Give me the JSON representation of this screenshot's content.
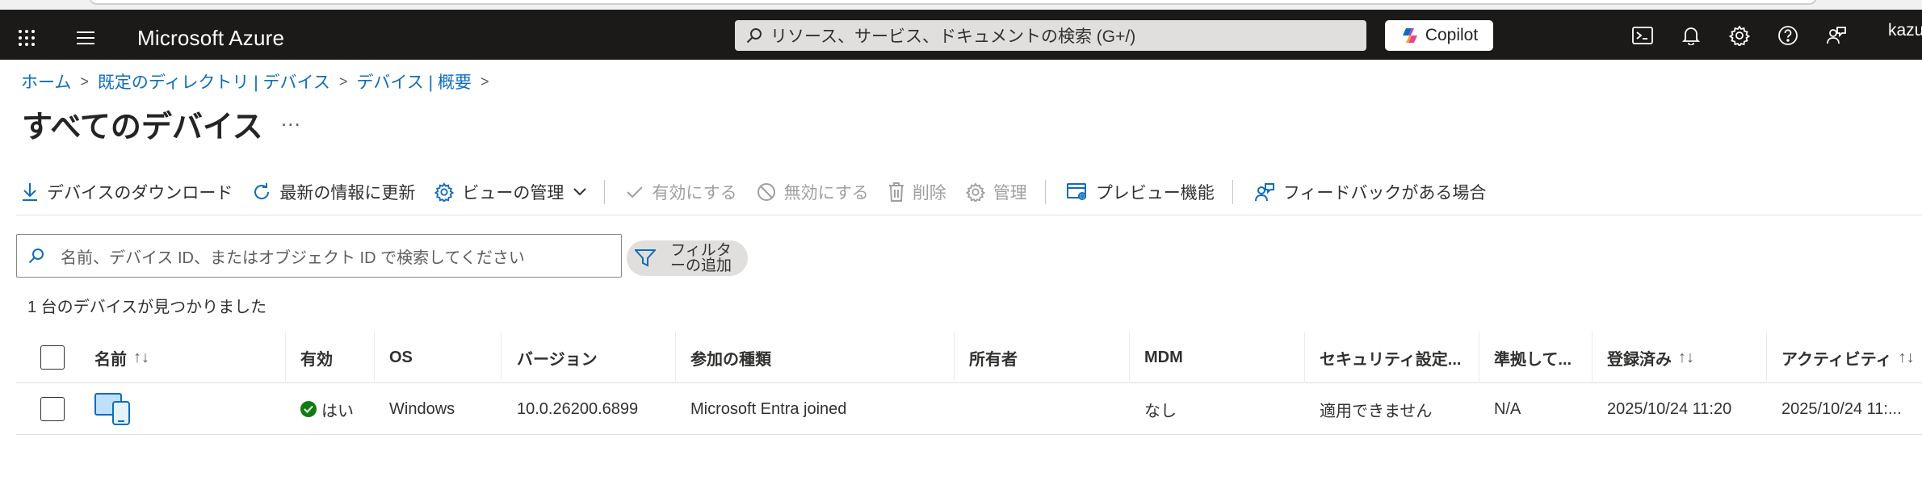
{
  "header": {
    "brand": "Microsoft Azure",
    "search_placeholder": "リソース、サービス、ドキュメントの検索 (G+/)",
    "copilot_label": "Copilot",
    "user": "kazu"
  },
  "breadcrumb": [
    "ホーム",
    "既定のディレクトリ | デバイス",
    "デバイス | 概要"
  ],
  "page": {
    "title": "すべてのデバイス",
    "more": "..."
  },
  "toolbar": {
    "download": "デバイスのダウンロード",
    "refresh": "最新の情報に更新",
    "manage_view": "ビューの管理",
    "enable": "有効にする",
    "disable": "無効にする",
    "delete": "削除",
    "manage": "管理",
    "preview": "プレビュー機能",
    "feedback": "フィードバックがある場合"
  },
  "filter": {
    "search_placeholder": "名前、デバイス ID、またはオブジェクト ID で検索してください",
    "add_filter": "フィルターの追加"
  },
  "result_count": "1 台のデバイスが見つかりました",
  "table": {
    "columns": {
      "name": "名前",
      "enabled": "有効",
      "os": "OS",
      "version": "バージョン",
      "join_type": "参加の種類",
      "owner": "所有者",
      "mdm": "MDM",
      "security": "セキュリティ設定...",
      "compliant": "準拠して...",
      "registered": "登録済み",
      "activity": "アクティビティ"
    },
    "rows": [
      {
        "enabled": "はい",
        "os": "Windows",
        "version": "10.0.26200.6899",
        "join_type": "Microsoft Entra joined",
        "owner": "",
        "mdm": "なし",
        "security": "適用できません",
        "compliant": "N/A",
        "registered": "2025/10/24 11:20",
        "activity": "2025/10/24 11:..."
      }
    ]
  },
  "colors": {
    "topbar": "#1b1a19",
    "link": "#0f6cbd",
    "success": "#107c10"
  }
}
